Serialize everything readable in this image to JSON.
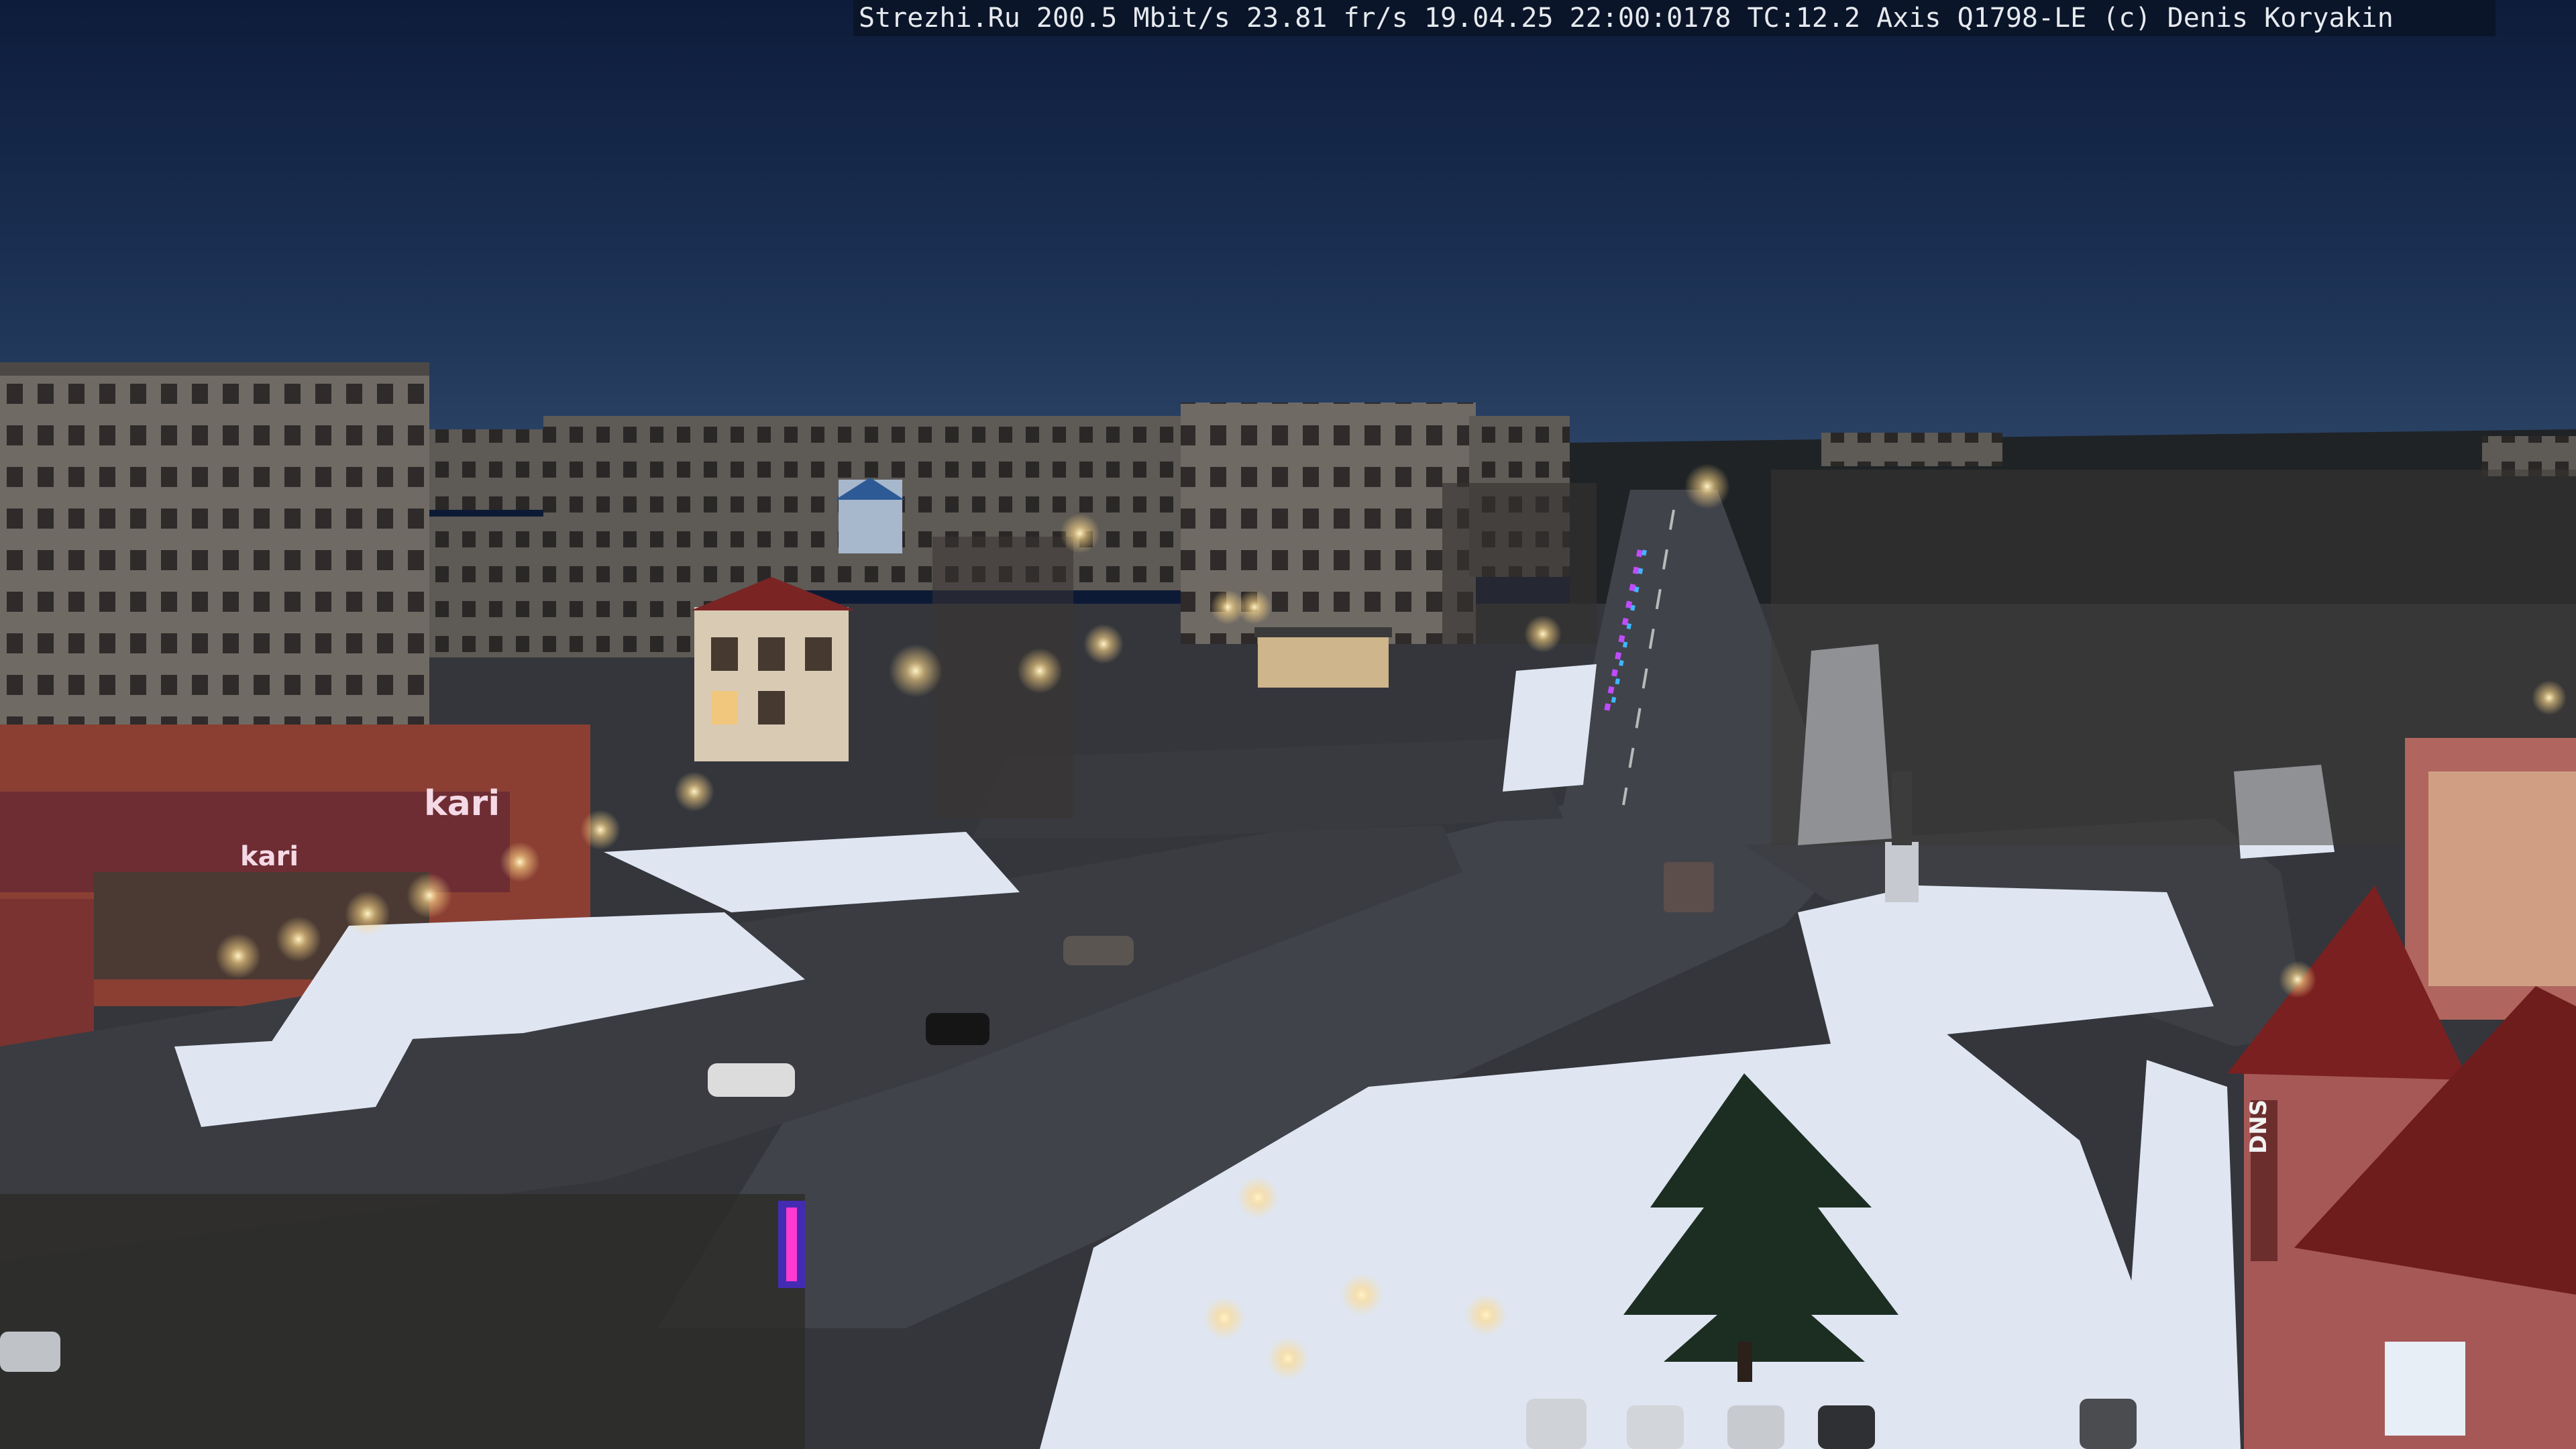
{
  "overlay": {
    "text": "Strezhi.Ru 200.5 Mbit/s 23.81 fr/s 19.04.25 22:00:0178 TC:12.2  Axis Q1798-LE  (c) Denis Koryakin"
  },
  "signs": {
    "left_store": "kari",
    "left_store_small": "kari",
    "right_store": "DNS"
  },
  "colors": {
    "sky_top": "#0f1d3d",
    "sky_horizon": "#2b4466",
    "snow": "#dfe6f2",
    "road": "#3c3f47",
    "brick_red": "#8d3d35",
    "streetlight": "#ffe7b0"
  }
}
